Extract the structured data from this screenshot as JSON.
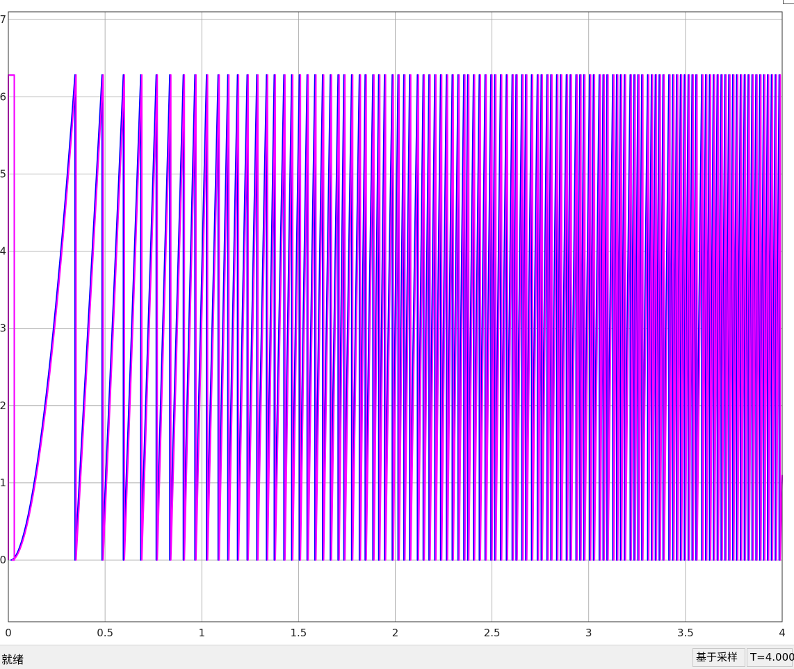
{
  "status": {
    "ready_text": "就绪",
    "mode_text": "基于采样",
    "time_text": "T=4.000"
  },
  "chart_data": {
    "type": "line",
    "title": "",
    "xlabel": "",
    "ylabel": "",
    "xlim": [
      0,
      4
    ],
    "ylim": [
      -0.8,
      7.1
    ],
    "xticks": [
      0,
      0.5,
      1,
      1.5,
      2,
      2.5,
      3,
      3.5,
      4
    ],
    "xtick_labels": [
      "0",
      "0.5",
      "1",
      "1.5",
      "2",
      "2.5",
      "3",
      "3.5",
      "4"
    ],
    "yticks": [
      0,
      1,
      2,
      3,
      4,
      5,
      6,
      7
    ],
    "ytick_labels": [
      "0",
      "1",
      "2",
      "3",
      "4",
      "5",
      "6",
      "7"
    ],
    "grid": true,
    "colors": {
      "series_a": "#0000ff",
      "series_b": "#ff00ff",
      "grid": "#a0a0a0"
    },
    "series": [
      {
        "description": "sawtooth angle wrapping between 0 and 2π, period shrinking as speed ramps up",
        "wrap_value": 6.2832,
        "wrap_times": [
          0.35,
          0.49,
          0.6,
          0.69,
          0.77,
          0.84,
          0.91,
          0.97,
          1.03,
          1.09,
          1.14,
          1.19,
          1.24,
          1.29,
          1.34,
          1.38,
          1.43,
          1.47,
          1.51,
          1.55,
          1.59,
          1.63,
          1.67,
          1.71,
          1.74,
          1.78,
          1.82,
          1.85,
          1.89,
          1.92,
          1.95,
          1.99,
          2.02,
          2.05,
          2.08,
          2.12,
          2.15,
          2.18,
          2.21,
          2.24,
          2.27,
          2.3,
          2.33,
          2.36,
          2.38,
          2.41,
          2.44,
          2.47,
          2.5,
          2.52,
          2.55,
          2.58,
          2.61,
          2.63,
          2.66,
          2.68,
          2.71,
          2.74,
          2.76,
          2.79,
          2.81,
          2.84,
          2.86,
          2.89,
          2.91,
          2.94,
          2.96,
          2.98,
          3.01,
          3.03,
          3.06,
          3.08,
          3.1,
          3.13,
          3.15,
          3.17,
          3.19,
          3.22,
          3.24,
          3.26,
          3.28,
          3.31,
          3.33,
          3.35,
          3.37,
          3.39,
          3.42,
          3.44,
          3.46,
          3.48,
          3.5,
          3.52,
          3.54,
          3.56,
          3.59,
          3.61,
          3.63,
          3.65,
          3.67,
          3.69,
          3.71,
          3.73,
          3.75,
          3.77,
          3.79,
          3.81,
          3.83,
          3.85,
          3.87,
          3.89,
          3.91,
          3.93,
          3.95,
          3.97,
          3.99
        ],
        "final_value_at_4": 1.1
      }
    ],
    "initial_spike": {
      "x": [
        0,
        0.02
      ],
      "y": 6.28
    }
  }
}
